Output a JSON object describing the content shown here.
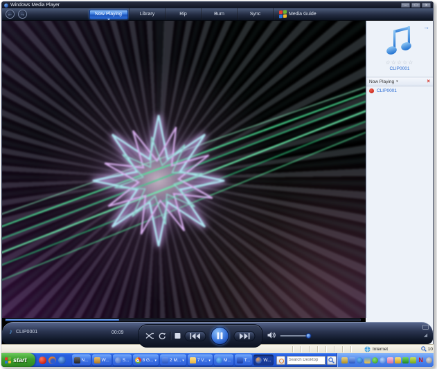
{
  "window": {
    "title": "Windows Media Player",
    "minimize": "–",
    "maximize": "□",
    "close": "x"
  },
  "nav": {
    "back": "←",
    "forward": "→"
  },
  "tabs": [
    {
      "label": "Now Playing",
      "active": true
    },
    {
      "label": "Library"
    },
    {
      "label": "Rip"
    },
    {
      "label": "Burn"
    },
    {
      "label": "Sync"
    },
    {
      "label": "Media Guide",
      "has_windows_logo": true
    }
  ],
  "sidebar": {
    "go_arrow": "→",
    "stars": "☆☆☆☆☆",
    "track_caption": "CLIP0001",
    "header": "Now Playing",
    "header_caret": "▾",
    "close_glyph": "×",
    "items": [
      {
        "label": "CLIP0001"
      }
    ]
  },
  "transport": {
    "note_glyph": "♪",
    "track": "CLIP0001",
    "elapsed": "00:09",
    "progress_pct": 32,
    "volume_pct": 85,
    "resize_glyph": "◢"
  },
  "statusbar": {
    "zone": "Internet",
    "zoom_level": "10"
  },
  "taskbar": {
    "start_label": "start",
    "group_caret": "▾",
    "buttons": [
      {
        "label": "N..."
      },
      {
        "label": "W..."
      },
      {
        "label": "S..."
      },
      {
        "label": "8 G...",
        "group": true
      },
      {
        "label": "2 M...",
        "group": true
      },
      {
        "label": "7 V...",
        "group": true
      },
      {
        "label": "M..."
      },
      {
        "label": "T..."
      },
      {
        "label": "W...",
        "active": true
      }
    ],
    "search_placeholder": "Search Desktop",
    "tray_n_label": "N"
  },
  "colors": {
    "accent_blue": "#2a6cd4",
    "viz_green": "#4ee89a",
    "viz_cyan": "#aee6f2",
    "viz_violet": "#d8b0f0",
    "taskbar_blue": "#2054d6",
    "start_green": "#3b9e2d",
    "alert_red": "#d22c20"
  }
}
